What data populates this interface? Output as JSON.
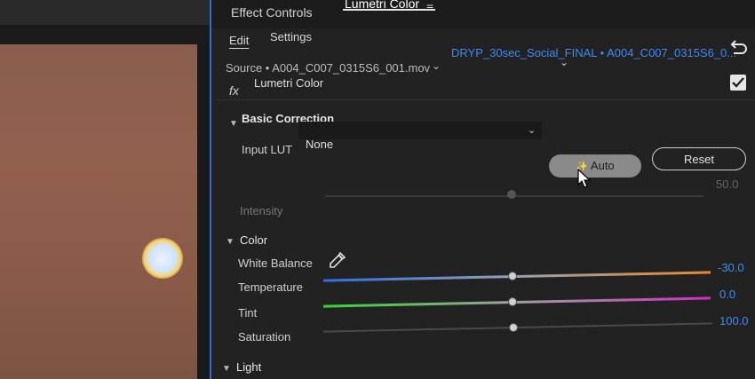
{
  "tabs": {
    "effect_controls": "Effect Controls",
    "lumetri_color": "Lumetri Color",
    "menu": "≡"
  },
  "subtabs": {
    "edit": "Edit",
    "settings": "Settings"
  },
  "source": {
    "label": "Source • A004_C007_0315S6_001.mov",
    "sequence": "DRYP_30sec_Social_FINAL • A004_C007_0315S6_0..."
  },
  "effect": {
    "fx": "fx",
    "name": "Lumetri Color",
    "enabled": true
  },
  "basic_correction": {
    "title": "Basic Correction",
    "input_lut_label": "Input LUT",
    "input_lut_value": "None",
    "auto_label": "Auto",
    "reset_label": "Reset",
    "intensity_label": "Intensity",
    "intensity_value": "50.0"
  },
  "color": {
    "title": "Color",
    "white_balance_label": "White Balance",
    "temperature_label": "Temperature",
    "temperature_value": "-30.0",
    "tint_label": "Tint",
    "tint_value": "0.0",
    "saturation_label": "Saturation",
    "saturation_value": "100.0"
  },
  "light": {
    "title": "Light"
  },
  "colors": {
    "accent": "#3d8bf5",
    "temperature_cold": "#2f6fe8",
    "temperature_warm": "#e88a2a",
    "tint_green": "#35d43a",
    "tint_magenta": "#d42cc8"
  }
}
